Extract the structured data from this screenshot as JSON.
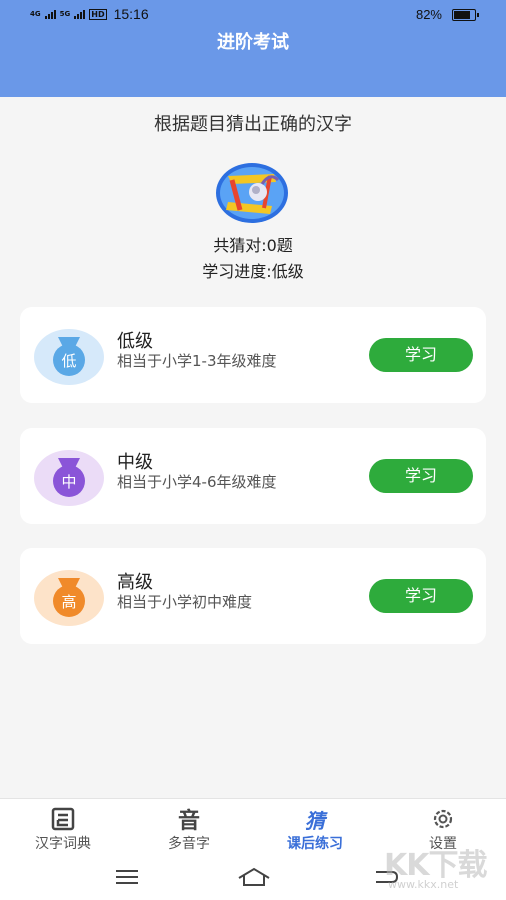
{
  "status_bar": {
    "net1": "4G",
    "net2": "5G",
    "hd": "HD",
    "time": "15:16",
    "battery": "82%"
  },
  "header": {
    "title": "进阶考试"
  },
  "main": {
    "subtitle": "根据题目猜出正确的汉字",
    "correct_count": "共猜对:0题",
    "progress": "学习进度:低级"
  },
  "levels": [
    {
      "badge": "低",
      "title": "低级",
      "desc": "相当于小学1-3年级难度",
      "button": "学习",
      "color": "#5aa8e6",
      "ring": "#d6e9fa"
    },
    {
      "badge": "中",
      "title": "中级",
      "desc": "相当于小学4-6年级难度",
      "button": "学习",
      "color": "#8a55d8",
      "ring": "#ebdcf7"
    },
    {
      "badge": "高",
      "title": "高级",
      "desc": "相当于小学初中难度",
      "button": "学习",
      "color": "#f08a2a",
      "ring": "#fde3c9"
    }
  ],
  "tabs": [
    {
      "label": "汉字词典",
      "icon": "dictionary-icon",
      "glyph": ""
    },
    {
      "label": "多音字",
      "icon": "sound-char-icon",
      "glyph": "音"
    },
    {
      "label": "课后练习",
      "icon": "guess-icon",
      "glyph": "猜"
    },
    {
      "label": "设置",
      "icon": "gear-icon",
      "glyph": ""
    }
  ],
  "watermark": {
    "text": "KK下载",
    "url": "www.kkx.net"
  },
  "colors": {
    "header": "#6a98e8",
    "button": "#2eab3c",
    "active_tab": "#3a6fd8"
  }
}
